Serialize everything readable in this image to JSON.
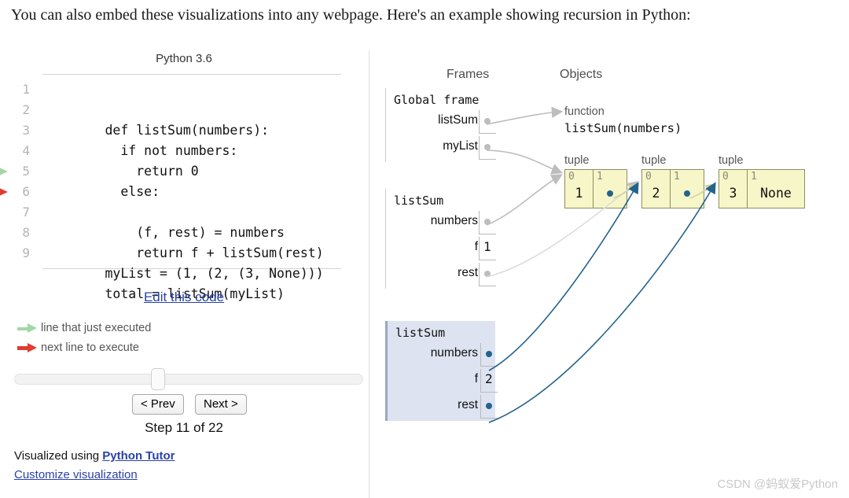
{
  "intro": "You can also embed these visualizations into any webpage. Here's an example showing recursion in Python:",
  "code_pane": {
    "python_version": "Python 3.6",
    "lines": [
      {
        "num": "1",
        "text": "def listSum(numbers):",
        "marker": "none"
      },
      {
        "num": "2",
        "text": "  if not numbers:",
        "marker": "none"
      },
      {
        "num": "3",
        "text": "    return 0",
        "marker": "none"
      },
      {
        "num": "4",
        "text": "  else:",
        "marker": "none"
      },
      {
        "num": "5",
        "text": "    (f, rest) = numbers",
        "marker": "green"
      },
      {
        "num": "6",
        "text": "    return f + listSum(rest)",
        "marker": "red"
      },
      {
        "num": "7",
        "text": "",
        "marker": "none"
      },
      {
        "num": "8",
        "text": "myList = (1, (2, (3, None)))",
        "marker": "none"
      },
      {
        "num": "9",
        "text": "total = listSum(myList)",
        "marker": "none"
      }
    ],
    "edit_link": "Edit this code",
    "legend": [
      {
        "label": "line that just executed",
        "color": "green"
      },
      {
        "label": "next line to execute",
        "color": "red"
      }
    ],
    "controls": {
      "prev_label": "< Prev",
      "next_label": "Next >",
      "step_label": "Step 11 of 22",
      "slider_value": 11,
      "slider_max": 22
    },
    "credit_prefix": "Visualized using ",
    "credit_link": "Python Tutor",
    "customize_link": "Customize visualization"
  },
  "right_pane": {
    "frames_heading": "Frames",
    "objects_heading": "Objects",
    "frames": [
      {
        "title": "Global frame",
        "active": false,
        "vars": [
          {
            "name": "listSum",
            "kind": "pointer",
            "value": ""
          },
          {
            "name": "myList",
            "kind": "pointer",
            "value": ""
          }
        ]
      },
      {
        "title": "listSum",
        "active": false,
        "vars": [
          {
            "name": "numbers",
            "kind": "pointer",
            "value": ""
          },
          {
            "name": "f",
            "kind": "value",
            "value": "1"
          },
          {
            "name": "rest",
            "kind": "pointer",
            "value": ""
          }
        ]
      },
      {
        "title": "listSum",
        "active": true,
        "vars": [
          {
            "name": "numbers",
            "kind": "pointer",
            "value": ""
          },
          {
            "name": "f",
            "kind": "value",
            "value": "2"
          },
          {
            "name": "rest",
            "kind": "pointer",
            "value": ""
          }
        ]
      }
    ],
    "objects": {
      "function": {
        "type_label": "function",
        "signature": "listSum(numbers)"
      },
      "tuples": [
        {
          "type_label": "tuple",
          "cells": [
            {
              "index": "0",
              "value": "1",
              "kind": "value"
            },
            {
              "index": "1",
              "value": "",
              "kind": "pointer"
            }
          ]
        },
        {
          "type_label": "tuple",
          "cells": [
            {
              "index": "0",
              "value": "2",
              "kind": "value"
            },
            {
              "index": "1",
              "value": "",
              "kind": "pointer"
            }
          ]
        },
        {
          "type_label": "tuple",
          "cells": [
            {
              "index": "0",
              "value": "3",
              "kind": "value"
            },
            {
              "index": "1",
              "value": "None",
              "kind": "value"
            }
          ]
        }
      ]
    }
  },
  "watermark": "CSDN @蚂蚁爱Python",
  "colors": {
    "green_arrow": "#a5d6a7",
    "red_arrow": "#e03c31",
    "link": "#2942a8",
    "tuple_fill": "#f7f6c8",
    "tuple_border": "#8c8c62",
    "active_frame_bg": "#dde3f0",
    "active_frame_border": "#9aa7c8",
    "gray_connector": "#bdbdbd",
    "blue_connector": "#23648c",
    "divider": "#dcdcdc"
  }
}
